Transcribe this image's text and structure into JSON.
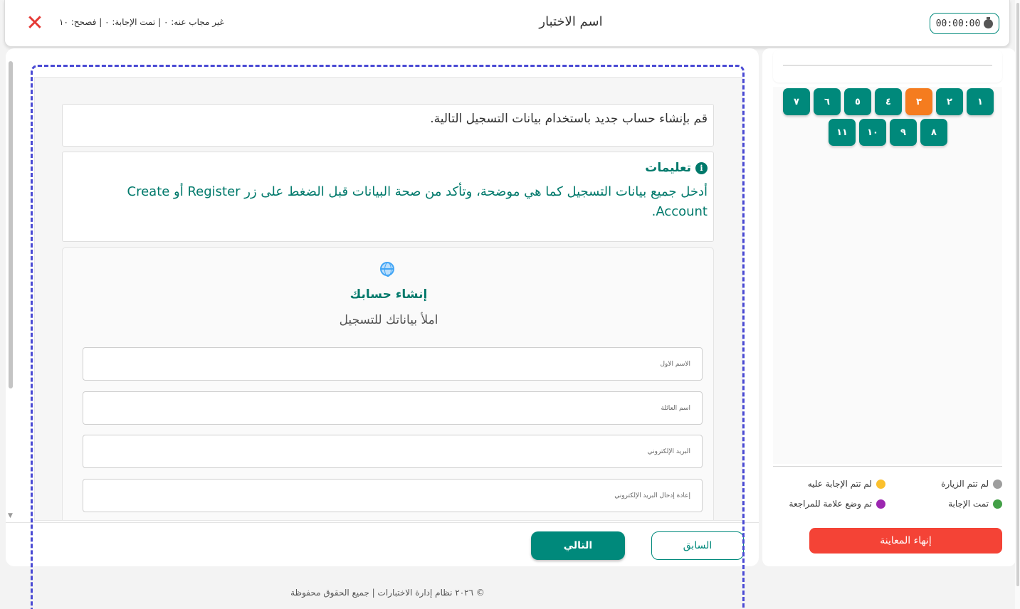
{
  "header": {
    "close_icon": "close-icon",
    "stats": "غير مجاب عنه: ٠ | تمت الإجابة: ٠ | فصحح: ١٠",
    "exam_title": "اسم الاختبار",
    "timer": "00:00:00",
    "timer_icon": "stopwatch-icon"
  },
  "question": {
    "text": "قم بإنشاء حساب جديد باستخدام بيانات التسجيل التالية."
  },
  "instructions": {
    "title": "تعليمات",
    "icon": "info-icon",
    "body": "أدخل جميع بيانات التسجيل كما هي موضحة، وتأكد من صحة البيانات قبل الضغط على زر Register أو Create Account."
  },
  "form": {
    "icon": "globe-icon",
    "title": "إنشاء حسابك",
    "subtitle": "املأ بياناتك للتسجيل",
    "fields": [
      {
        "placeholder": "الاسم الأول"
      },
      {
        "placeholder": "اسم العائلة"
      },
      {
        "placeholder": "البريد الإلكتروني"
      },
      {
        "placeholder": "إعادة إدخال البريد الإلكتروني"
      }
    ]
  },
  "navigation": {
    "next_label": "التالي",
    "prev_label": "السابق"
  },
  "footer": {
    "text": "© ٢٠٢٦ نظام إدارة الاختبارات | جميع الحقوق محفوظة"
  },
  "question_nav": {
    "current": "٣",
    "current_color": "#f57c1f",
    "default_color": "#00897b",
    "items": [
      "١",
      "٢",
      "٣",
      "٤",
      "٥",
      "٦",
      "٧",
      "٨",
      "٩",
      "١٠",
      "١١"
    ]
  },
  "legend": {
    "not_visited": {
      "label": "لم تتم الزيارة",
      "color": "#9e9e9e"
    },
    "not_answered": {
      "label": "لم تتم الإجابة عليه",
      "color": "#fbc02d"
    },
    "answered": {
      "label": "تمت الإجابة",
      "color": "#43a047"
    },
    "marked": {
      "label": "تم وضع علامة للمراجعة",
      "color": "#9c27b0"
    }
  },
  "finish_label": "إنهاء المعاينة"
}
